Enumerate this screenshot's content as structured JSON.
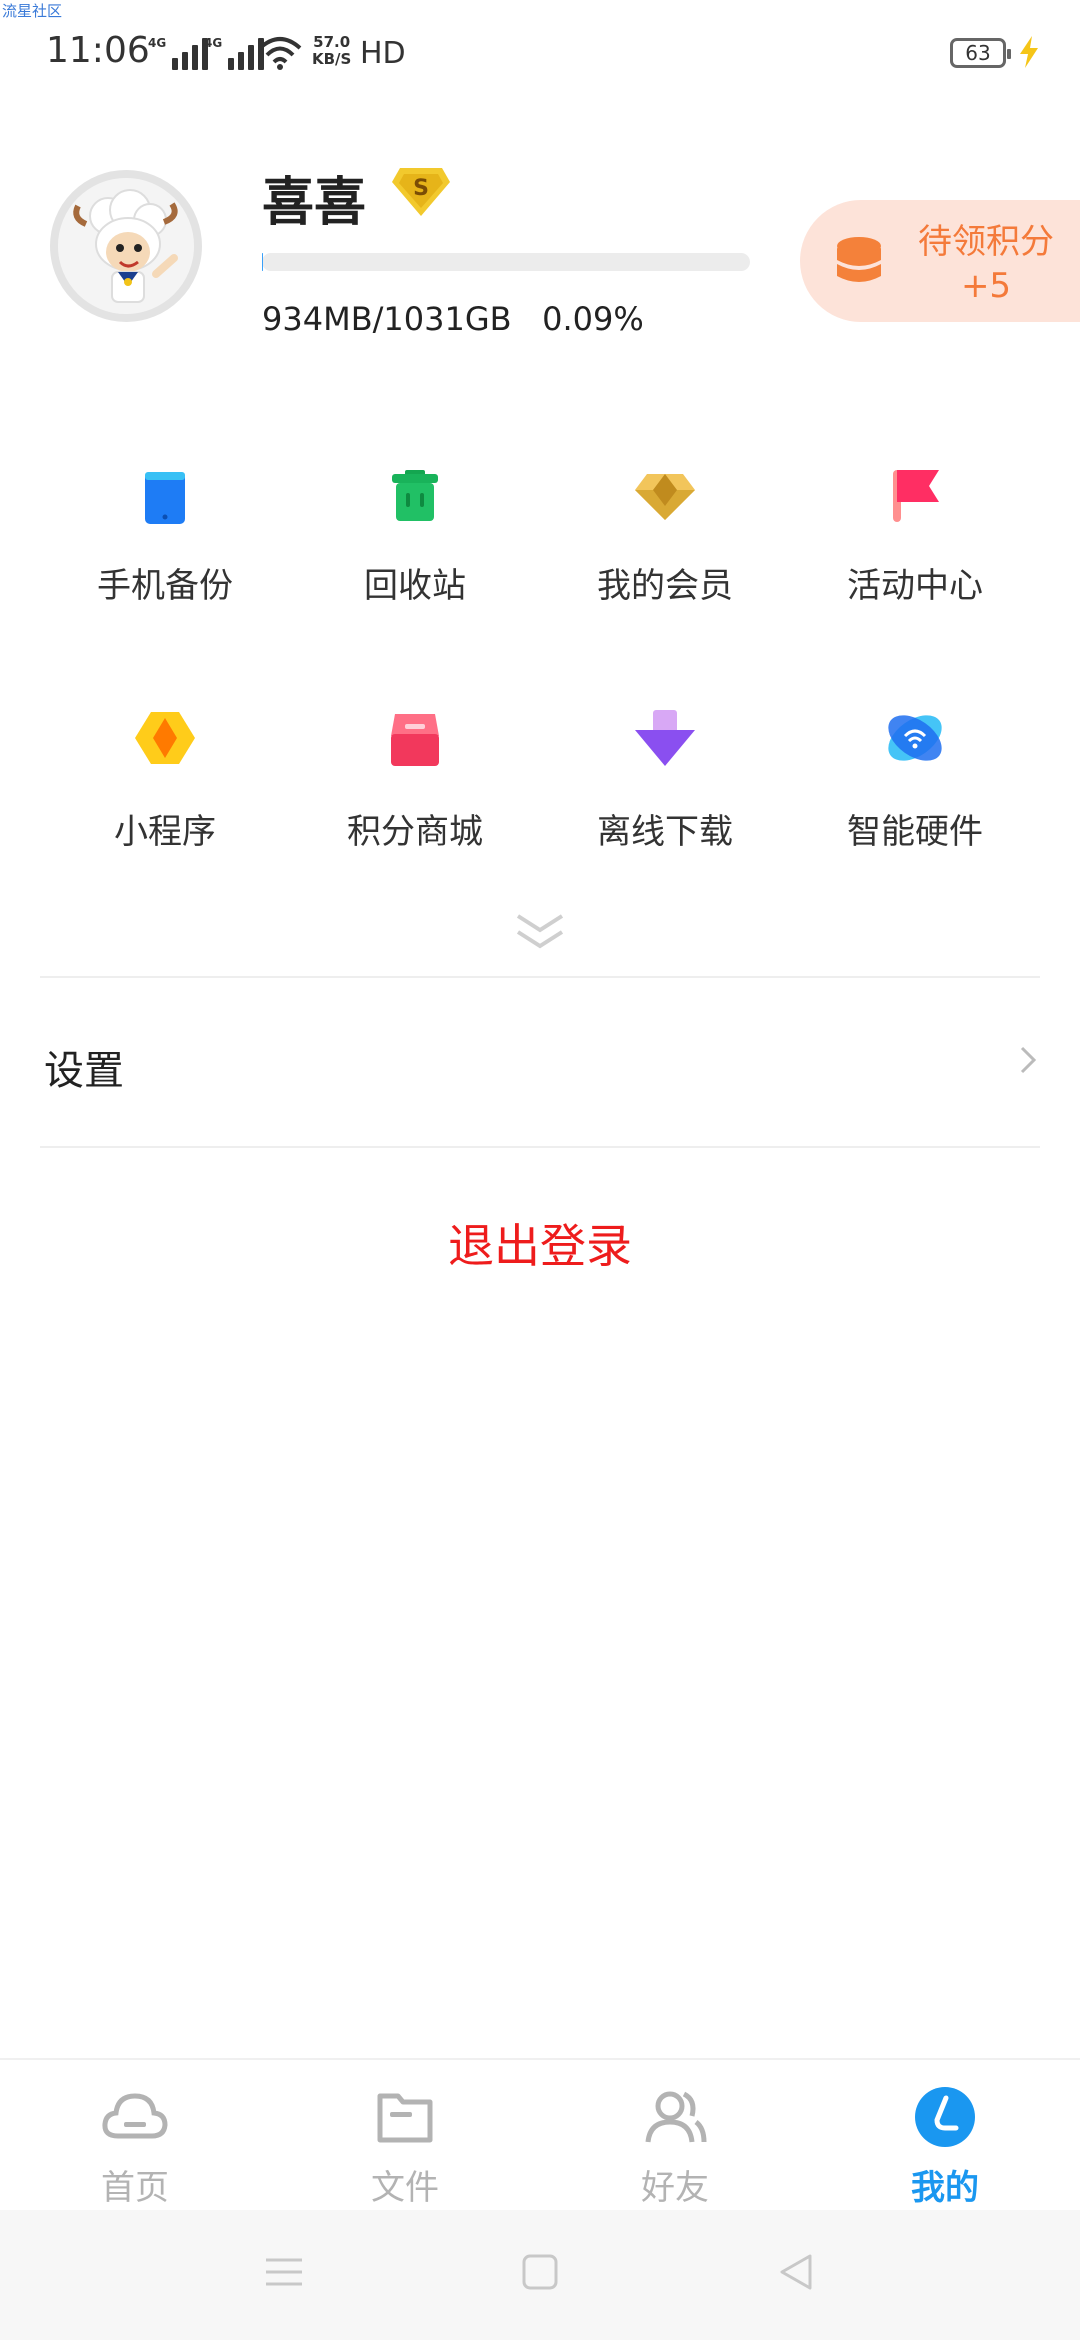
{
  "watermark": "流星社区",
  "status": {
    "time": "11:06",
    "network_1": "4G",
    "network_2": "4G",
    "speed_value": "57.0",
    "speed_unit": "KB/S",
    "hd": "HD",
    "battery": "63"
  },
  "profile": {
    "username": "喜喜",
    "vip_letter": "S",
    "storage_text": "934MB/1031GB   0.09%",
    "storage_fraction": 0.0009,
    "points_line1": "待领积分",
    "points_line2": "+5"
  },
  "grid": [
    {
      "label": "手机备份",
      "icon": "phone-backup-icon"
    },
    {
      "label": "回收站",
      "icon": "recycle-bin-icon"
    },
    {
      "label": "我的会员",
      "icon": "diamond-icon"
    },
    {
      "label": "活动中心",
      "icon": "flag-icon"
    },
    {
      "label": "小程序",
      "icon": "mini-program-icon"
    },
    {
      "label": "积分商城",
      "icon": "store-icon"
    },
    {
      "label": "离线下载",
      "icon": "download-arrow-icon"
    },
    {
      "label": "智能硬件",
      "icon": "smart-hardware-icon"
    }
  ],
  "settings": {
    "label": "设置"
  },
  "logout": {
    "label": "退出登录"
  },
  "nav": {
    "home": "首页",
    "files": "文件",
    "friends": "好友",
    "mine": "我的",
    "active": "mine"
  },
  "colors": {
    "accent": "#1a97f0",
    "logout": "#ee1c1c",
    "points_text": "#f47a3a",
    "points_bg": "#fde3d9"
  }
}
